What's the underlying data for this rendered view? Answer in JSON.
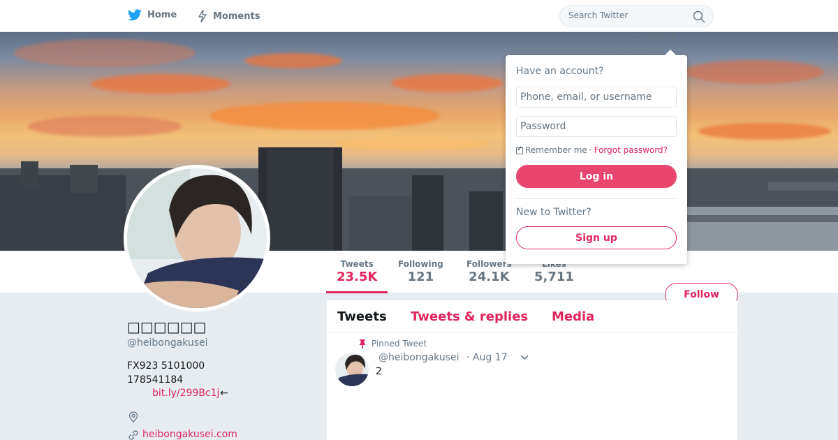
{
  "nav": {
    "home_label": "Home",
    "moments_label": "Moments",
    "search_placeholder": "Search Twitter"
  },
  "login_bar": {
    "prompt": "Have an account?",
    "login_label": "Log in"
  },
  "login_dropdown": {
    "title": "Have an account?",
    "username_placeholder": "Phone, email, or username",
    "password_placeholder": "Password",
    "remember_label": "Remember me",
    "separator": "·",
    "forgot_label": "Forgot password?",
    "login_button": "Log in",
    "new_prompt": "New to Twitter?",
    "signup_button": "Sign up"
  },
  "stats": [
    {
      "label": "Tweets",
      "value": "23.5K",
      "active": true
    },
    {
      "label": "Following",
      "value": "121"
    },
    {
      "label": "Followers",
      "value": "24.1K"
    },
    {
      "label": "Likes",
      "value": "5,711"
    }
  ],
  "follow_button": "Follow",
  "profile": {
    "name": "□□□□□□",
    "handle": "@heibongakusei",
    "bio_line1": "FX923 5101000",
    "bio_line2": "178541184",
    "bio_link": "bit.ly/299Bc1j",
    "bio_arrow": "←",
    "url": "heibongakusei.com"
  },
  "tabs": [
    {
      "label": "Tweets",
      "active": true
    },
    {
      "label": "Tweets & replies"
    },
    {
      "label": "Media"
    }
  ],
  "pinned_tweet": {
    "pinned_label": "Pinned Tweet",
    "handle": "@heibongakusei",
    "date": "· Aug 17",
    "text": "2"
  },
  "colors": {
    "accent": "#e0245e",
    "login_button_bg": "#e8466f",
    "nav_text": "#66757f",
    "page_bg": "#e6ecf0",
    "twitter_blue": "#1da1f2"
  },
  "icons": {
    "home": "twitter-bird-icon",
    "moments": "lightning-icon",
    "search": "magnifier-icon",
    "pin": "pin-icon",
    "location": "location-pin-icon",
    "url": "link-icon",
    "caret": "chevron-down-icon"
  }
}
